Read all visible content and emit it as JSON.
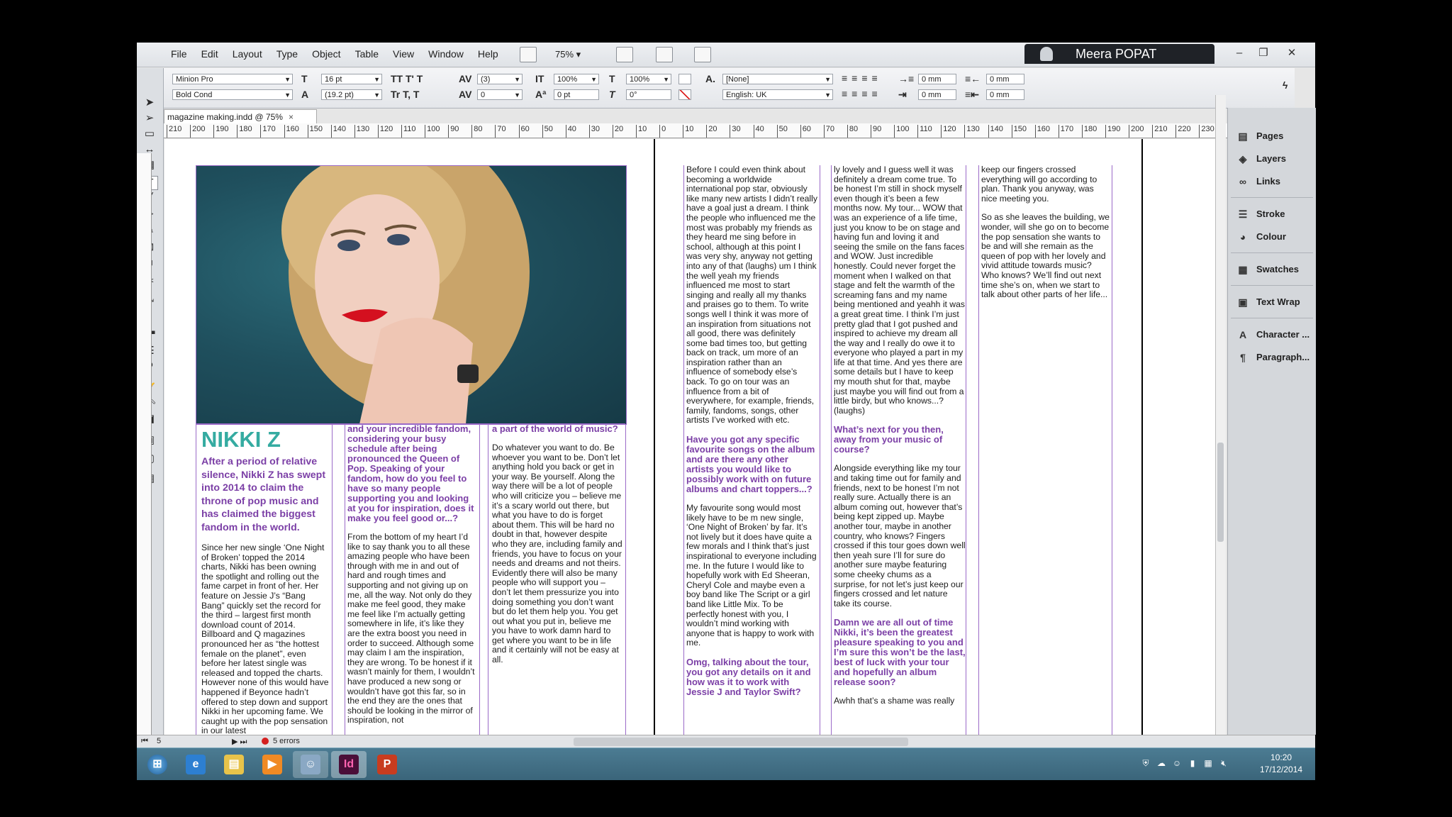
{
  "app": {
    "menu": [
      "File",
      "Edit",
      "Layout",
      "Type",
      "Object",
      "Table",
      "View",
      "Window",
      "Help"
    ],
    "zoom": "75%",
    "user_name": "Meera POPAT",
    "doc_tab": "magazine making.indd @ 75%",
    "doc_tab_close": "×"
  },
  "control": {
    "font_family": "Minion Pro",
    "font_style": "Bold Cond",
    "font_size": "16 pt",
    "leading": "(19.2 pt)",
    "kerning": "(3)",
    "tracking": "0",
    "vscale": "100%",
    "hscale": "100%",
    "baseline": "0 pt",
    "skew": "0°",
    "char_style": "[None]",
    "language": "English: UK",
    "indent_left": "0 mm",
    "indent_first": "0 mm",
    "indent_right": "0 mm",
    "indent_last": "0 mm"
  },
  "ruler": [
    "210",
    "200",
    "190",
    "180",
    "170",
    "160",
    "150",
    "140",
    "130",
    "120",
    "110",
    "100",
    "90",
    "80",
    "70",
    "60",
    "50",
    "40",
    "30",
    "20",
    "10",
    "0",
    "10",
    "20",
    "30",
    "40",
    "50",
    "60",
    "70",
    "80",
    "90",
    "100",
    "110",
    "120",
    "130",
    "140",
    "150",
    "160",
    "170",
    "180",
    "190",
    "200",
    "210",
    "220",
    "230"
  ],
  "panels": [
    "Pages",
    "Layers",
    "Links",
    "Stroke",
    "Colour",
    "Swatches",
    "Text Wrap",
    "Character ...",
    "Paragraph..."
  ],
  "status": {
    "page": "5",
    "errors": "5 errors"
  },
  "clock": {
    "time": "10:20",
    "date": "17/12/2014"
  },
  "article": {
    "headline": "NIKKI Z",
    "intro": "After a period of relative silence, Nikki Z has swept into 2014 to claim the throne of pop music and has claimed the biggest fandom in the world.",
    "col1": "Since her new single ‘One Night of Broken’ topped the 2014 charts, Nikki has been owning the spotlight and rolling out the fame carpet in front of her. Her feature on Jessie J’s “Bang Bang” quickly set the record for the third – largest first month download count of 2014. Billboard and Q magazines pronounced her as “the hottest female on the planet”, even before her latest single was released and topped the charts. However none of this would have happened if Beyonce hadn’t offered to step down and support Nikki in her upcoming fame. We caught up with the pop sensation in our latest",
    "col2_q": "and your incredible fandom, considering your busy schedule after being pronounced the Queen of Pop. Speaking of your fandom, how do you feel to have so many people supporting you and looking at you for inspiration, does it make you feel good or...?",
    "col2": "From the bottom of my heart I’d like to say thank you to all these amazing people who have been through with me in and out of hard and rough times and supporting and not giving up on me, all the way. Not only do they make me feel good, they make me feel like I’m actually getting somewhere in life, it’s like they are the extra boost you need in order to succeed. Although some may claim I am the inspiration, they are wrong. To be honest if it wasn’t mainly for them, I wouldn’t have produced a new song or wouldn’t have got this far, so in the end they are the ones that should be looking in the mirror of inspiration, not",
    "col3_q": "a part of the world of music?",
    "col3": "Do whatever you want to do. Be whoever you want to be. Don’t let anything hold you back or get in your way. Be yourself. Along the way there will be a lot of people who will criticize you – believe me it’s a scary world out there, but what you have to do is forget about them. This will be hard no doubt in that, however despite who they are, including family and friends, you have to focus on your needs and dreams and not theirs. Evidently there will also be many people who will support you – don’t let them pressurize you into doing something you don’t want but do let them help you. You get out what you put in, believe me you have to work damn hard to get where you want to be in life and it certainly will not be easy at all.",
    "col4": "Before I could even think about becoming a worldwide international pop star, obviously like many new artists I didn’t really have a goal just a dream. I think the people who influenced me the most was probably my friends as they heard me sing before in school, although at this point I was very shy, anyway not getting into any of that (laughs) um I think the well yeah my friends influenced me most to start singing and really all my thanks and praises go to them. To write songs well I think it was more of an inspiration from situations not all good, there was definitely some bad times too, but getting back on track, um more of an inspiration rather than an influence of somebody else’s back. To go on tour was an influence from a bit of everywhere, for example, friends, family, fandoms, songs, other artists I’ve worked with etc.",
    "col4_q1": "Have you got any specific favourite songs on the album and are there any other artists you would like to possibly work with on future albums and chart toppers...?",
    "col4_b": "My favourite song would most likely have to be m new single, ‘One Night of Broken’ by far. It’s not lively but it does have quite a few morals and I think that’s just inspirational to everyone including me. In the future I would like to hopefully work with Ed Sheeran, Cheryl Cole and maybe even a boy band like The Script or a girl band like Little Mix. To be perfectly honest with you, I wouldn’t mind working with anyone that is happy to work with me.",
    "col4_q2": "Omg, talking about the tour, you got any details on it and how was it to work with Jessie J and Taylor Swift?",
    "col5": "ly lovely and I guess well it was definitely a dream come true. To be honest I’m still in shock myself even though it’s been a few months now. My tour... WOW that was an experience of a life time, just you know to be on stage and having fun and loving it and seeing the smile on the fans faces and WOW. Just incredible honestly. Could never forget the moment when I walked on that stage and felt the warmth of the screaming fans and my name being mentioned and yeahh it was a great great time. I think I’m just pretty glad that I got pushed and inspired to achieve my dream all the way and I really do owe it to everyone who played a part in my life at that time. And yes there are some details but I have to keep my mouth shut for that, maybe just maybe you will find out from a little birdy, but who knows...? (laughs)",
    "col5_q1": "What’s next for you then, away from your music of course?",
    "col5_b": "Alongside everything like my tour and taking time out for family and friends, next to be honest I’m not really sure. Actually there is an album coming out, however that’s being kept zipped up. Maybe another tour, maybe in another country, who knows? Fingers crossed if this tour goes down well then yeah sure I’ll for sure do another sure maybe featuring some cheeky chums as a surprise, for not let’s just keep our fingers crossed and let nature take its course.",
    "col5_q2": "Damn we are all out of time Nikki, it’s been the greatest pleasure speaking to you and I’m sure this won’t be the last, best of luck with your tour and hopefully an album release soon?",
    "col5_c": "Awhh that’s a shame was really",
    "col6_a": "keep our fingers crossed everything will go according to plan. Thank you anyway, was nice meeting you.",
    "col6_b": "So as she leaves the building, we wonder, will she go on to become the pop sensation she wants to be and will she remain as the queen of pop with her lovely and vivid attitude towards music? Who knows? We’ll find out next time she’s on, when we start to talk about other parts of her life..."
  }
}
